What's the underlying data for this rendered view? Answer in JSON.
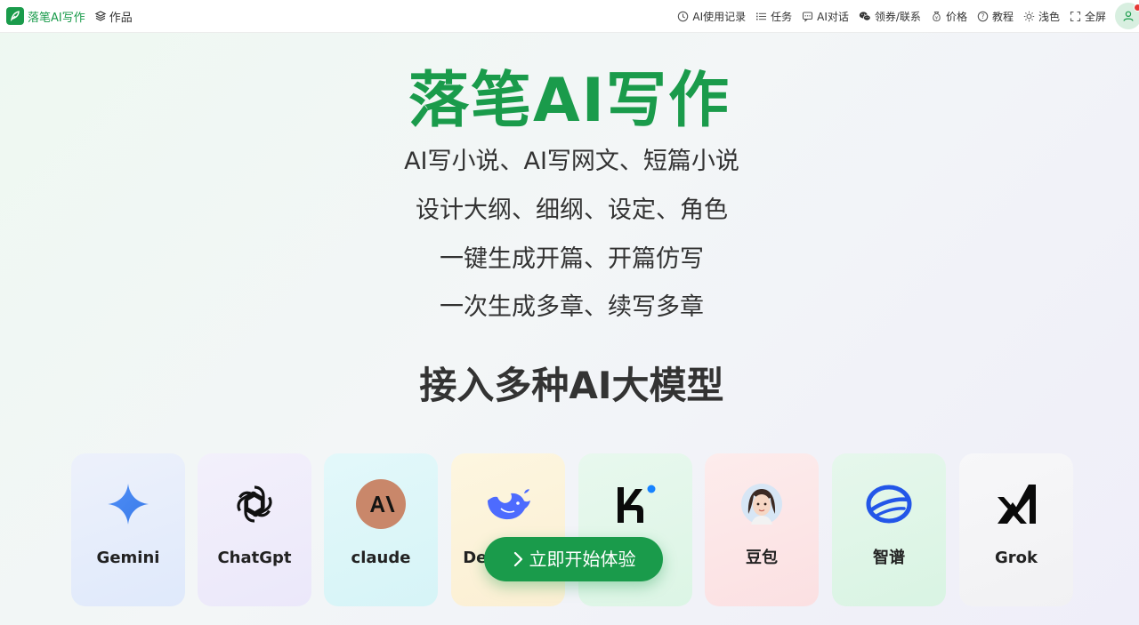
{
  "header": {
    "brand": {
      "name": "落笔AI写作"
    },
    "works_label": "作品",
    "nav": [
      {
        "label": "AI使用记录",
        "icon": "clock-icon"
      },
      {
        "label": "任务",
        "icon": "list-icon"
      },
      {
        "label": "AI对话",
        "icon": "chat-icon"
      },
      {
        "label": "领券/联系",
        "icon": "wechat-icon"
      },
      {
        "label": "价格",
        "icon": "price-icon"
      },
      {
        "label": "教程",
        "icon": "help-icon"
      },
      {
        "label": "浅色",
        "icon": "sun-icon"
      },
      {
        "label": "全屏",
        "icon": "fullscreen-icon"
      }
    ]
  },
  "hero": {
    "title": "落笔AI写作",
    "features": [
      "AI写小说、AI写网文、短篇小说",
      "设计大纲、细纲、设定、角色",
      "一键生成开篇、开篇仿写",
      "一次生成多章、续写多章"
    ]
  },
  "models": {
    "heading": "接入多种AI大模型",
    "items": [
      {
        "label": "Gemini",
        "icon": "gemini-icon"
      },
      {
        "label": "ChatGpt",
        "icon": "chatgpt-icon"
      },
      {
        "label": "claude",
        "icon": "claude-icon"
      },
      {
        "label": "DeepSeek",
        "icon": "deepseek-icon"
      },
      {
        "label": "Kimi",
        "icon": "kimi-icon"
      },
      {
        "label": "豆包",
        "icon": "doubao-icon"
      },
      {
        "label": "智谱",
        "icon": "zhipu-icon"
      },
      {
        "label": "Grok",
        "icon": "grok-icon"
      }
    ]
  },
  "cta": {
    "label": "立即开始体验",
    "icon": "chevron-right-icon"
  },
  "colors": {
    "brand": "#1a9b4b",
    "text": "#333333",
    "notification": "#e53935"
  }
}
